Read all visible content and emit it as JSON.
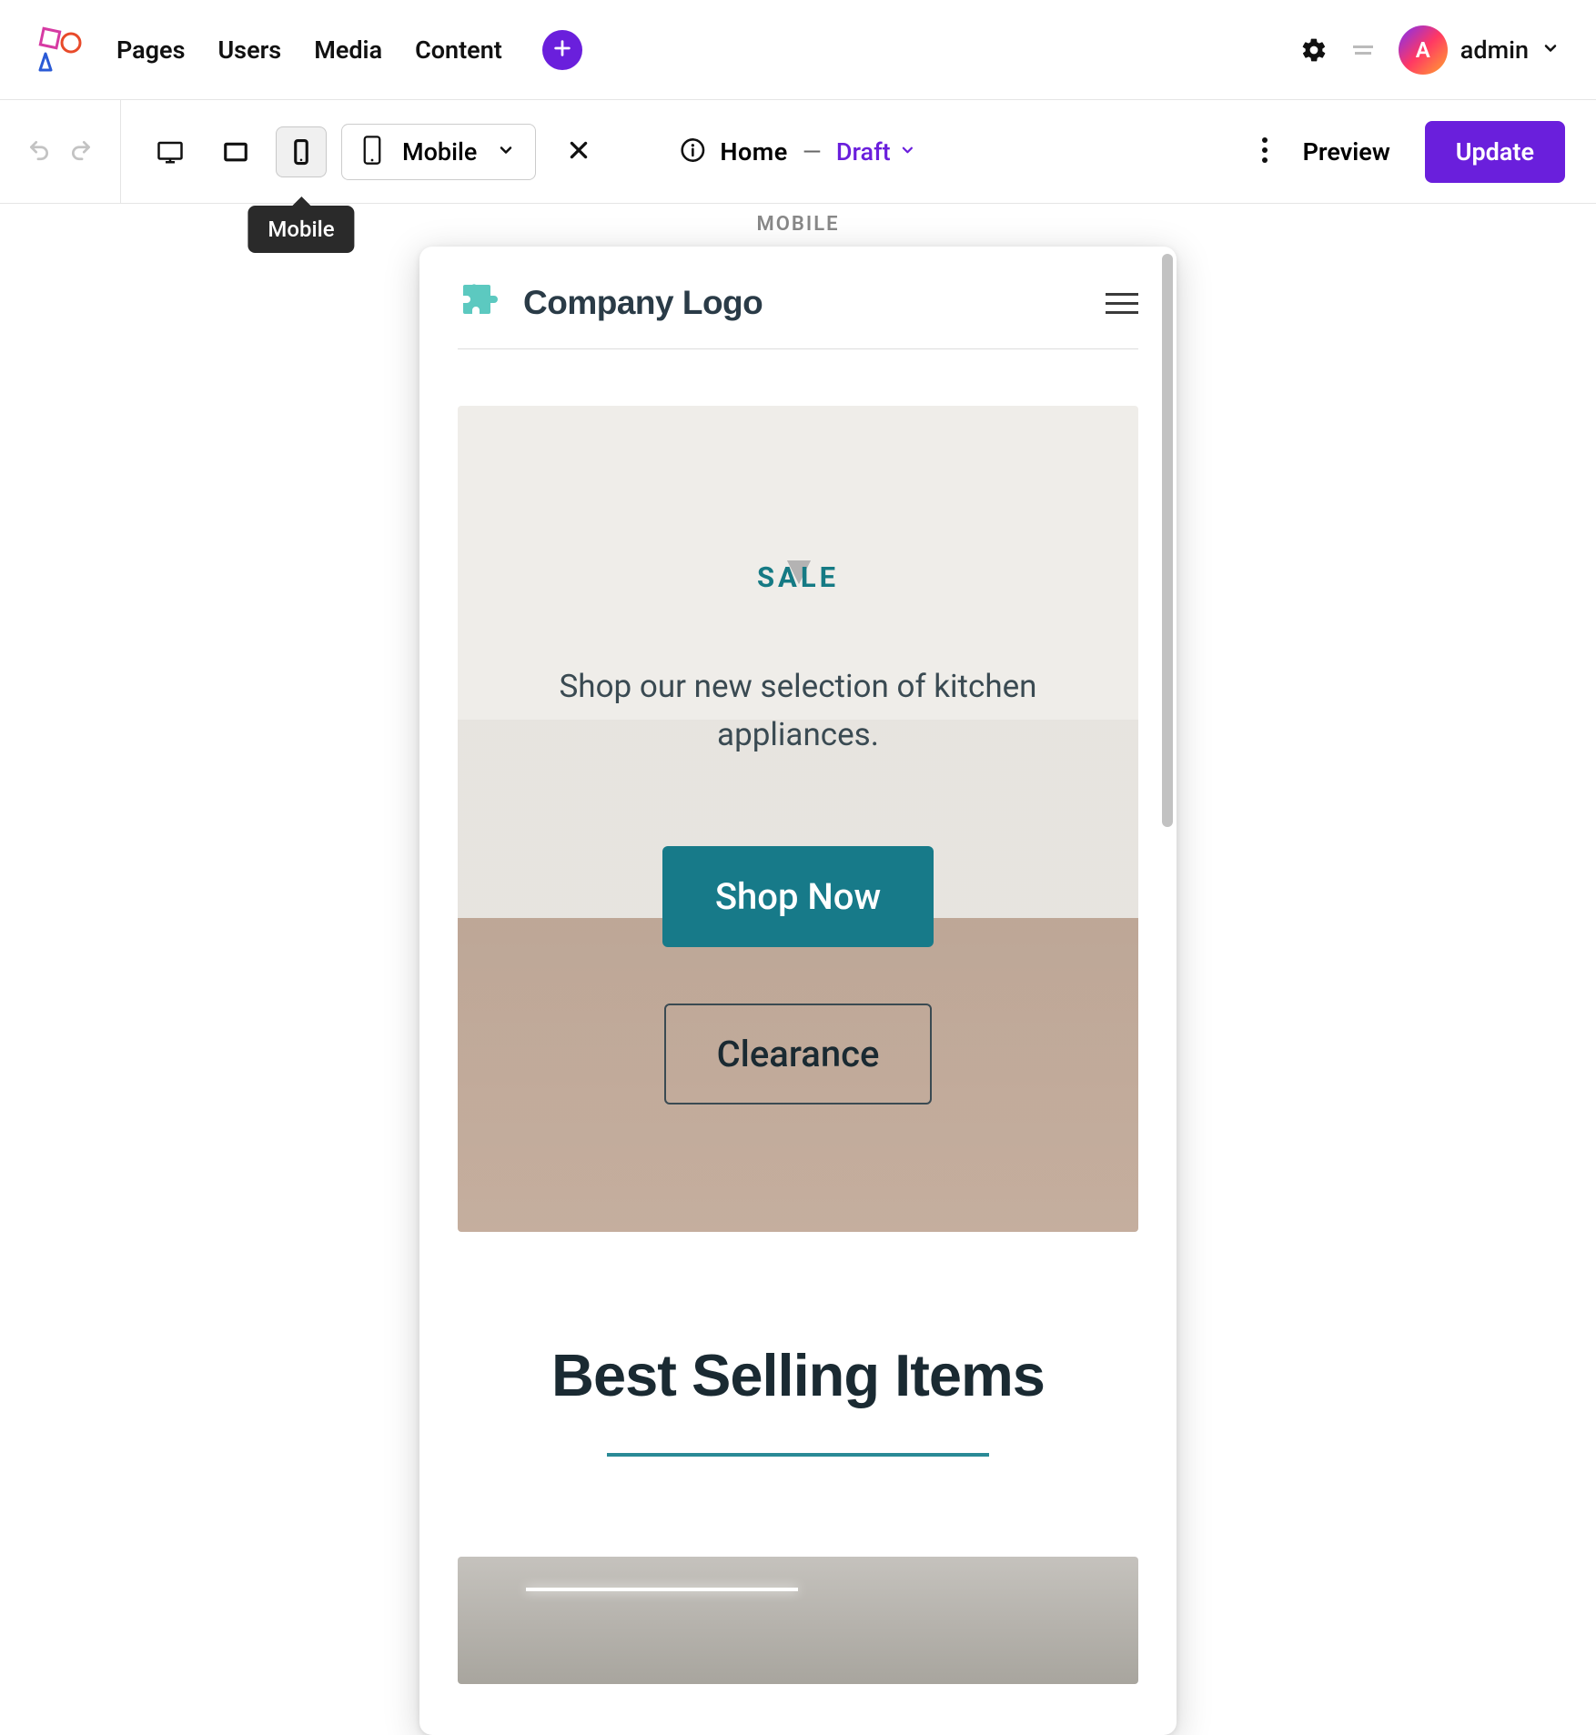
{
  "topbar": {
    "nav": {
      "pages": "Pages",
      "users": "Users",
      "media": "Media",
      "content": "Content"
    },
    "user": {
      "initial": "A",
      "name": "admin"
    }
  },
  "toolbar": {
    "device_select_label": "Mobile",
    "tooltip": "Mobile",
    "page_title": "Home",
    "dash": "—",
    "status_label": "Draft",
    "preview_label": "Preview",
    "update_label": "Update"
  },
  "canvas": {
    "label": "MOBILE",
    "site": {
      "logo_text": "Company Logo",
      "hero_eyebrow": "SALE",
      "hero_text": "Shop our new selection of kitchen appliances.",
      "cta_primary": "Shop Now",
      "cta_secondary": "Clearance",
      "section_title": "Best Selling Items"
    }
  },
  "colors": {
    "accent": "#6a1fdc",
    "site_teal": "#177a89"
  }
}
